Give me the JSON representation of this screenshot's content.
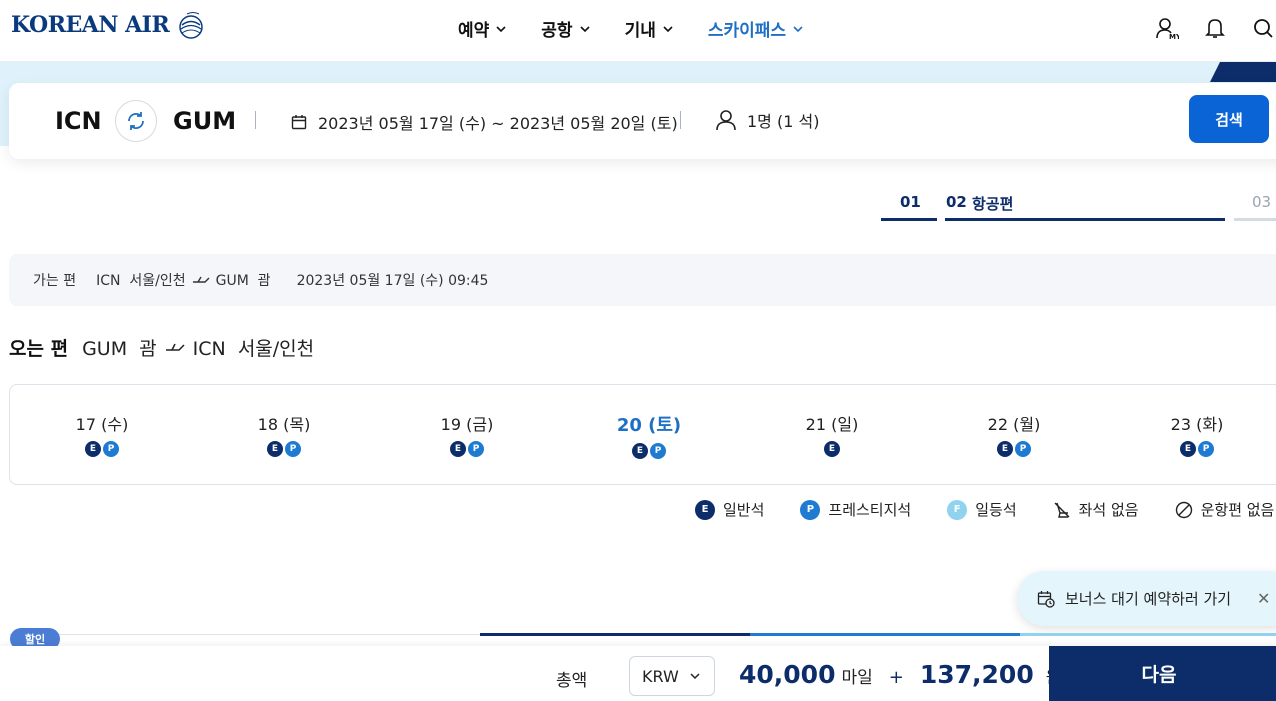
{
  "header": {
    "logo_text": "KOREAN AIR",
    "nav": [
      {
        "label": "예약"
      },
      {
        "label": "공항"
      },
      {
        "label": "기내"
      },
      {
        "label": "스카이패스",
        "active": true
      }
    ],
    "icons": [
      "user-my-icon",
      "bell-icon",
      "search-icon"
    ]
  },
  "search": {
    "origin": "ICN",
    "destination": "GUM",
    "dates": "2023년 05월 17일 (수) ~ 2023년 05월 20일 (토)",
    "passengers": "1명 (1 석)",
    "search_label": "검색"
  },
  "steps": [
    {
      "num": "01",
      "label": ""
    },
    {
      "num": "02",
      "label": "항공편"
    },
    {
      "num": "03",
      "label": ""
    }
  ],
  "outbound": {
    "label": "가는 편",
    "from": "ICN  서울/인천",
    "to": "GUM  괌",
    "datetime": "2023년 05월 17일 (수) 09:45"
  },
  "return": {
    "title": "오는 편",
    "from": "GUM  괌",
    "to": "ICN  서울/인천"
  },
  "date_tabs": [
    {
      "label": "17 (수)",
      "badges": [
        "E",
        "P"
      ]
    },
    {
      "label": "18 (목)",
      "badges": [
        "E",
        "P"
      ]
    },
    {
      "label": "19 (금)",
      "badges": [
        "E",
        "P"
      ]
    },
    {
      "label": "20 (토)",
      "badges": [
        "E",
        "P"
      ],
      "selected": true
    },
    {
      "label": "21 (일)",
      "badges": [
        "E"
      ]
    },
    {
      "label": "22 (월)",
      "badges": [
        "E",
        "P"
      ]
    },
    {
      "label": "23 (화)",
      "badges": [
        "E",
        "P"
      ]
    }
  ],
  "legend": {
    "economy": "일반석",
    "prestige": "프레스티지석",
    "first": "일등석",
    "no_seat": "좌석 없음",
    "no_flight": "운항편 없음"
  },
  "bonus": {
    "label": "보너스 대기 예약하러 가기"
  },
  "discount_tag": "할인",
  "bottom": {
    "total_label": "총액",
    "currency": "KRW",
    "miles": "40,000",
    "miles_unit": "마일",
    "plus": "+",
    "won": "137,200",
    "won_unit": "원",
    "next_label": "다음"
  },
  "colors": {
    "navy": "#0d2d6a",
    "accent_blue": "#0a64d6",
    "prestige_blue": "#1f7ad1",
    "first_sky": "#8fd3ef",
    "band": "#dff2fb"
  }
}
